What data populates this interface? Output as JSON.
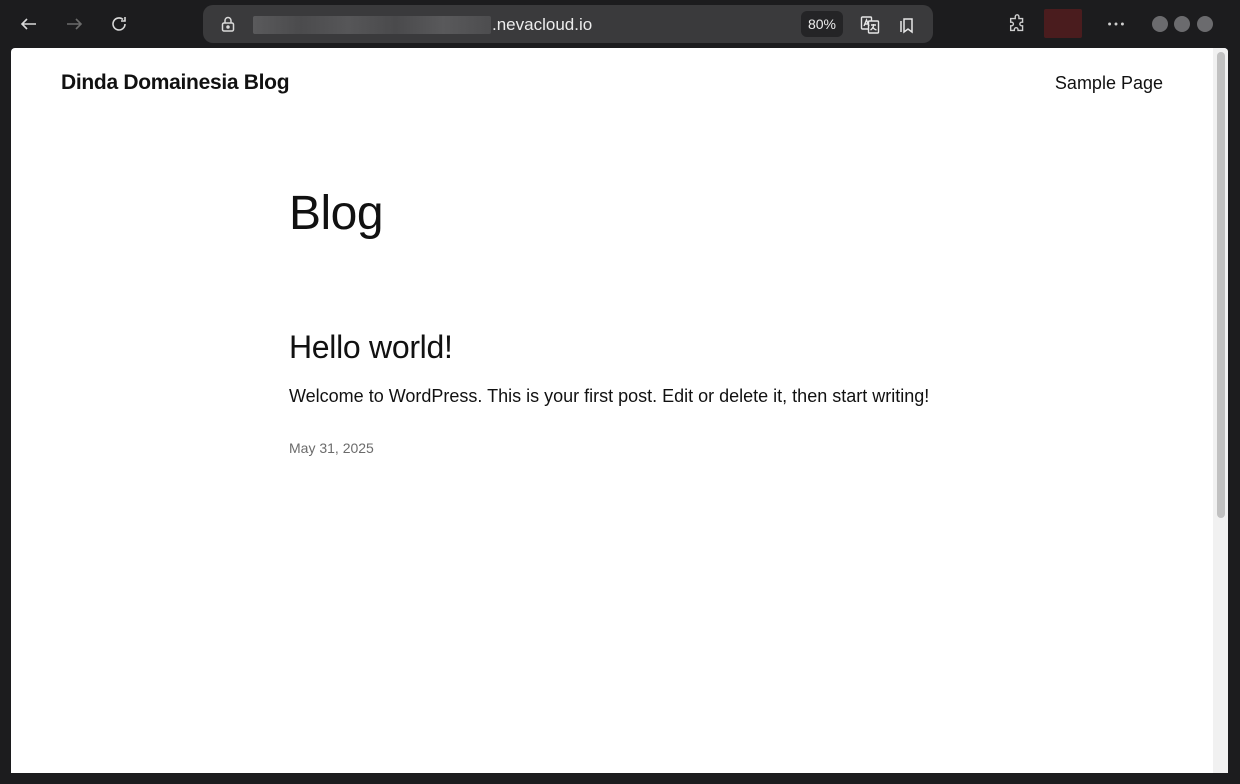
{
  "browser": {
    "url_visible_text": ".nevacloud.io",
    "zoom": "80%",
    "icons": {
      "back": "arrow-left-icon",
      "forward": "arrow-right-icon",
      "reload": "reload-icon",
      "lock": "lock-icon",
      "translate": "translate-icon",
      "reading_list": "bookmark-icon",
      "extensions": "puzzle-icon",
      "menu": "more-icon"
    },
    "profile_color": "#4a1c1e"
  },
  "site": {
    "title": "Dinda Domainesia Blog",
    "nav": [
      "Sample Page"
    ]
  },
  "page": {
    "title": "Blog"
  },
  "posts": [
    {
      "title": "Hello world!",
      "excerpt": "Welcome to WordPress. This is your first post. Edit or delete it, then start writing!",
      "date": "May 31, 2025"
    }
  ]
}
